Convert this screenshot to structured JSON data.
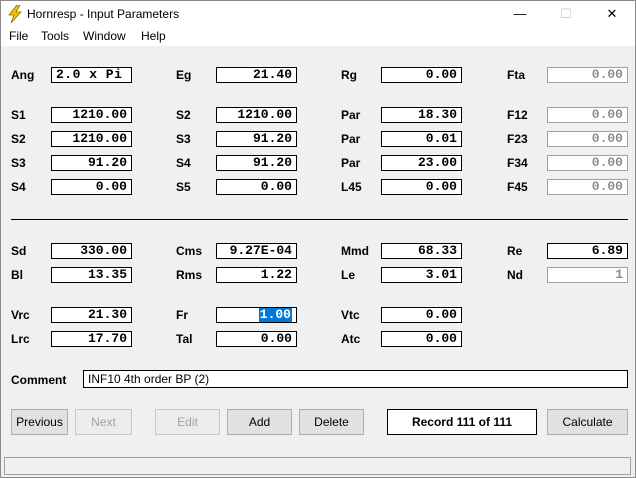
{
  "window": {
    "title": "Hornresp - Input Parameters",
    "minimize": "—",
    "maximize": "☐",
    "close": "✕"
  },
  "menu": [
    "File",
    "Tools",
    "Window",
    "Help"
  ],
  "labels": {
    "ang": "Ang",
    "eg": "Eg",
    "rg": "Rg",
    "fta": "Fta",
    "s1": "S1",
    "s2a": "S2",
    "par1": "Par",
    "f12": "F12",
    "s2b": "S2",
    "s3a": "S3",
    "par2": "Par",
    "f23": "F23",
    "s3b": "S3",
    "s4a": "S4",
    "par3": "Par",
    "f34": "F34",
    "s4b": "S4",
    "s5": "S5",
    "l45": "L45",
    "f45": "F45",
    "sd": "Sd",
    "cms": "Cms",
    "mmd": "Mmd",
    "re": "Re",
    "bl": "Bl",
    "rms": "Rms",
    "le": "Le",
    "nd": "Nd",
    "vrc": "Vrc",
    "fr": "Fr",
    "vtc": "Vtc",
    "lrc": "Lrc",
    "tal": "Tal",
    "atc": "Atc",
    "comment": "Comment"
  },
  "values": {
    "ang": "2.0 x Pi",
    "eg": "21.40",
    "rg": "0.00",
    "fta": "0.00",
    "s1": "1210.00",
    "s2a": "1210.00",
    "par1": "18.30",
    "f12": "0.00",
    "s2b": "1210.00",
    "s3a": "91.20",
    "par2": "0.01",
    "f23": "0.00",
    "s3b": "91.20",
    "s4a": "91.20",
    "par3": "23.00",
    "f34": "0.00",
    "s4b": "0.00",
    "s5": "0.00",
    "l45": "0.00",
    "f45": "0.00",
    "sd": "330.00",
    "cms": "9.27E-04",
    "mmd": "68.33",
    "re": "6.89",
    "bl": "13.35",
    "rms": "1.22",
    "le": "3.01",
    "nd": "1",
    "vrc": "21.30",
    "fr": "1.00",
    "vtc": "0.00",
    "lrc": "17.70",
    "tal": "0.00",
    "atc": "0.00",
    "comment": "INF10 4th order BP (2)"
  },
  "buttons": {
    "previous": "Previous",
    "next": "Next",
    "edit": "Edit",
    "add": "Add",
    "delete": "Delete",
    "calculate": "Calculate"
  },
  "record": "Record 111 of 111",
  "colors": {
    "selection": "#0078d7",
    "icon": "#f2c400"
  }
}
